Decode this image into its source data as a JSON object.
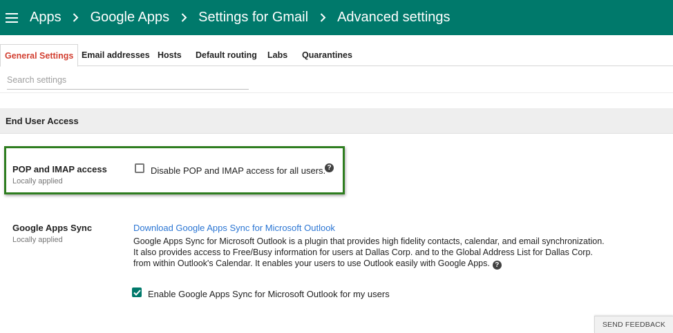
{
  "header": {
    "breadcrumbs": [
      "Apps",
      "Google Apps",
      "Settings for Gmail",
      "Advanced settings"
    ]
  },
  "tabs": [
    "General Settings",
    "Email addresses",
    "Hosts",
    "Default routing",
    "Labs",
    "Quarantines"
  ],
  "active_tab": "General Settings",
  "search": {
    "placeholder": "Search settings",
    "value": ""
  },
  "section": {
    "title": "End User Access"
  },
  "pop_imap": {
    "name": "POP and IMAP access",
    "sub": "Locally applied",
    "checkbox_label": "Disable POP and IMAP access for all users.",
    "checked": false
  },
  "apps_sync": {
    "name": "Google Apps Sync",
    "sub": "Locally applied",
    "link": "Download Google Apps Sync for Microsoft Outlook",
    "desc_line1": "Google Apps Sync for Microsoft Outlook is a plugin that provides high fidelity contacts, calendar, and email synchronization.",
    "desc_line2": "It also provides access to Free/Busy information  for users at Dallas Corp. and to the Global Address List for Dallas Corp.",
    "desc_line3": "from within Outlook's Calendar. It enables your users to use Outlook easily with Google Apps.",
    "checkbox_label": "Enable Google Apps Sync for Microsoft Outlook for my users",
    "checked": true
  },
  "feedback_label": "SEND FEEDBACK",
  "colors": {
    "header_bg": "#00796b",
    "active_tab": "#d23f31",
    "link": "#2a75d3",
    "highlight_border": "#2e7d1f"
  },
  "icons": [
    "menu-icon",
    "chevron-right-icon",
    "help-icon",
    "checkmark-icon"
  ]
}
